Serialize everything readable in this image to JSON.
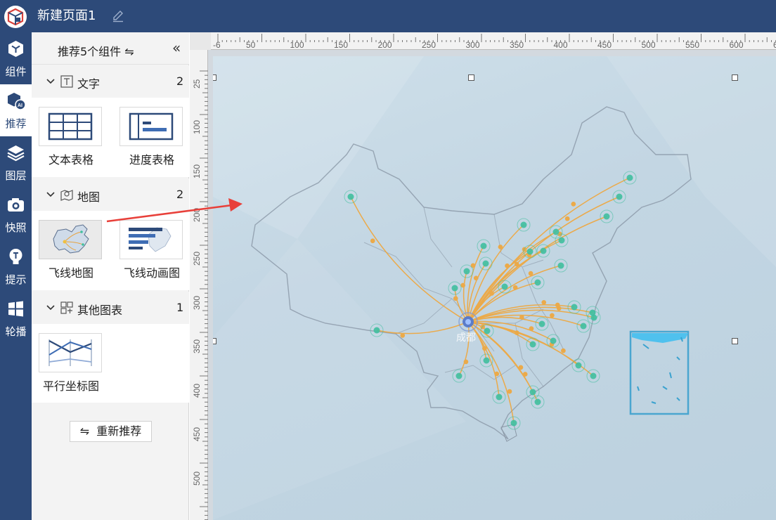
{
  "header": {
    "title": "新建页面1",
    "logo_icon": "app-cube-logo",
    "edit_icon": "pencil-icon",
    "bg_color": "#2d4a79"
  },
  "nav": {
    "items": [
      {
        "label": "组件",
        "icon": "cube-icon",
        "active": false
      },
      {
        "label": "推荐",
        "icon": "ai-cube-icon",
        "active": true
      },
      {
        "label": "图层",
        "icon": "layers-icon",
        "active": false
      },
      {
        "label": "快照",
        "icon": "camera-icon",
        "active": false
      },
      {
        "label": "提示",
        "icon": "lightbulb-icon",
        "active": false
      },
      {
        "label": "轮播",
        "icon": "carousel-icon",
        "active": false
      }
    ]
  },
  "panel": {
    "title": "推荐5个组件 ⇋",
    "collapse_glyph": "«",
    "groups": [
      {
        "label": "文字",
        "count": "2",
        "icon": "text-box-icon",
        "items": [
          {
            "label": "文本表格"
          },
          {
            "label": "进度表格"
          }
        ]
      },
      {
        "label": "地图",
        "count": "2",
        "icon": "map-pin-icon",
        "items": [
          {
            "label": "飞线地图",
            "selected": true
          },
          {
            "label": "飞线动画图"
          }
        ]
      },
      {
        "label": "其他图表",
        "count": "1",
        "icon": "grid-chart-icon",
        "items": [
          {
            "label": "平行坐标图"
          }
        ]
      }
    ],
    "refresh_label": "重新推荐",
    "refresh_icon": "swap-icon"
  },
  "canvas": {
    "ruler_top_labels": [
      "-6",
      "50",
      "100",
      "150",
      "200",
      "250",
      "300",
      "350",
      "400",
      "450",
      "500",
      "550",
      "600",
      "650"
    ],
    "ruler_left_labels": [
      "25",
      "100",
      "150",
      "200",
      "250",
      "300",
      "350",
      "400",
      "450",
      "500"
    ],
    "map_center_label": "成都",
    "accent_color": "#f0a63a",
    "node_color": "#3fbf9f",
    "annotation_arrow_color": "#e8403a"
  }
}
